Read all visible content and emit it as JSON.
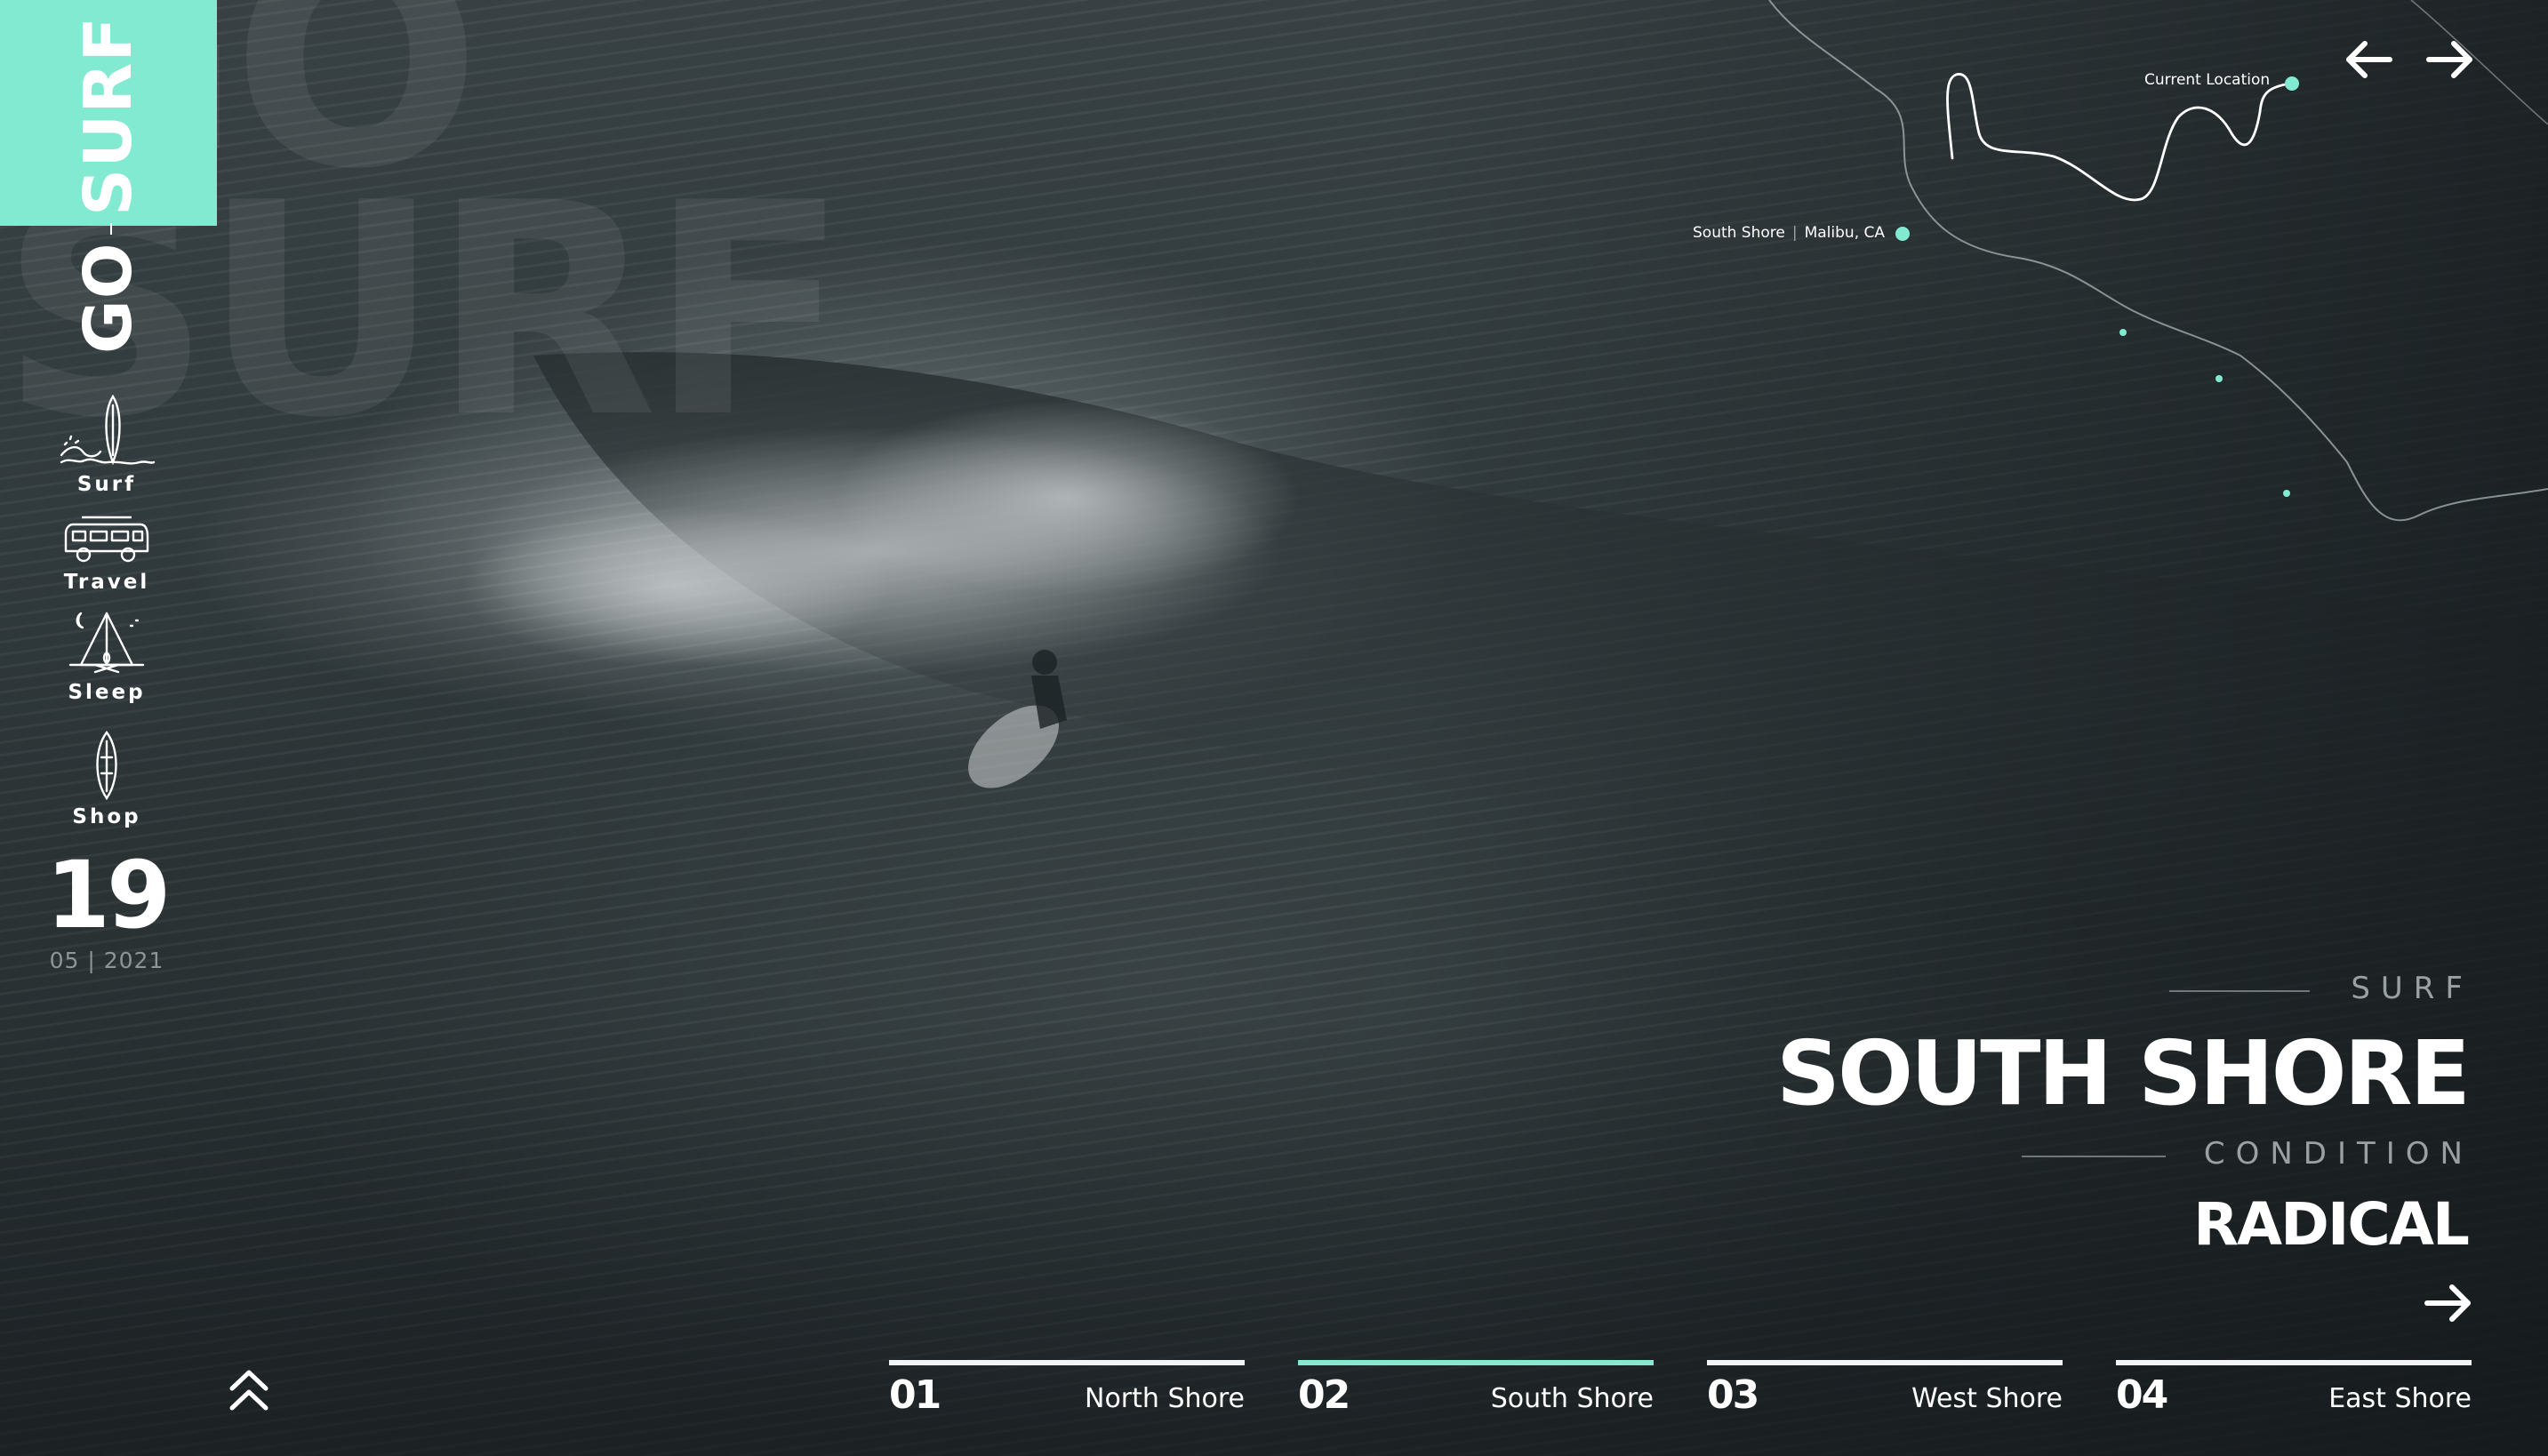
{
  "brand": {
    "word1": "GO",
    "word2": "SURF",
    "watermark": "GO\nSURF",
    "accent_color": "#82ead0"
  },
  "sidebar": {
    "items": [
      {
        "label": "Surf",
        "icon": "surfboard-wave-icon"
      },
      {
        "label": "Travel",
        "icon": "camper-van-icon"
      },
      {
        "label": "Sleep",
        "icon": "campfire-tent-icon"
      },
      {
        "label": "Shop",
        "icon": "surfboard-icon"
      }
    ],
    "date": {
      "day": "19",
      "month_year": "05 | 2021"
    },
    "scroll_up_icon": "double-chevron-up-icon"
  },
  "top_nav": {
    "prev_icon": "arrow-left-icon",
    "next_icon": "arrow-right-icon"
  },
  "map": {
    "current_location_label": "Current Location",
    "spot_name": "South Shore",
    "spot_place": "Malibu, CA"
  },
  "spot": {
    "kicker": "SURF",
    "name": "SOUTH SHORE",
    "condition_label": "CONDITION",
    "condition_value": "RADICAL",
    "go_icon": "arrow-right-icon"
  },
  "tabs": [
    {
      "num": "01",
      "name": "North Shore",
      "active": false
    },
    {
      "num": "02",
      "name": "South Shore",
      "active": true
    },
    {
      "num": "03",
      "name": "West Shore",
      "active": false
    },
    {
      "num": "04",
      "name": "East Shore",
      "active": false
    }
  ]
}
